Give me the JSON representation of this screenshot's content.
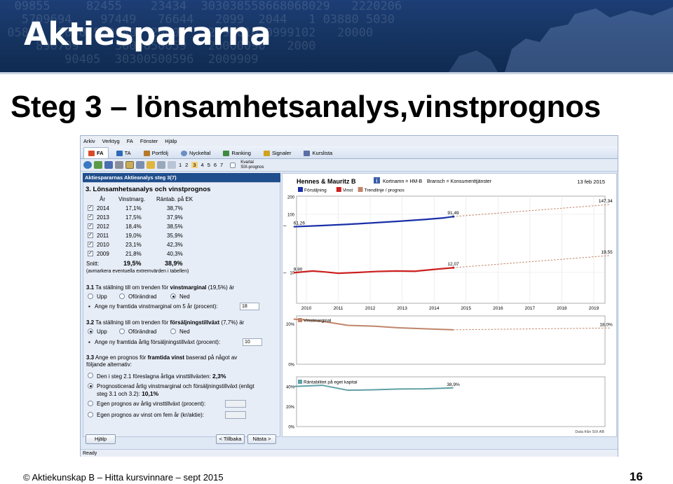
{
  "banner": {
    "logo": "Aktiespararna",
    "bg_numbers": "  09855     82455    23434  303038558668068029   2220206\n   5709694    97449   76644   2099  2044   1 03880 5030\n 05800  2000 500080  2000    299101010999102   20000\n     890709     3000050059   20000090   2000\n         90405  30300500596  2009909  "
  },
  "slide": {
    "title": "Steg 3 – lönsamhetsanalys,vinstprognos",
    "footer": "© Aktiekunskap B – Hitta kursvinnare – sept 2015",
    "page_number": "16"
  },
  "app": {
    "menu": [
      "Arkiv",
      "Verktyg",
      "FA",
      "Fönster",
      "Hjälp"
    ],
    "tabs": [
      {
        "label": "FA",
        "active": true,
        "color": "#d94a2a"
      },
      {
        "label": "TA",
        "active": false,
        "color": "#2e6bb8"
      },
      {
        "label": "Portfölj",
        "active": false,
        "color": "#b57a2a"
      },
      {
        "label": "Nyckeltal",
        "active": false,
        "color": "#6a8fc4"
      },
      {
        "label": "Ranking",
        "active": false,
        "color": "#3f8a3f"
      },
      {
        "label": "Signaler",
        "active": false,
        "color": "#d1a21c"
      },
      {
        "label": "Kurslista",
        "active": false,
        "color": "#5a6fa5"
      }
    ],
    "toolbar": {
      "steps": [
        "1",
        "2",
        "3",
        "4",
        "5",
        "6",
        "7"
      ],
      "kvartal": "Kvartal",
      "six": "SIX-prognos"
    },
    "panel_header": "Aktiespararnas Aktieanalys steg 3(7)",
    "section_title": "3. Lönsamhetsanalys och vinstprognos",
    "table": {
      "headers": [
        "År",
        "Vinstmarg.",
        "Räntab. på EK"
      ],
      "rows": [
        {
          "year": "2014",
          "margin": "17,1%",
          "roe": "38,7%",
          "checked": true
        },
        {
          "year": "2013",
          "margin": "17,5%",
          "roe": "37,9%",
          "checked": true
        },
        {
          "year": "2012",
          "margin": "18,4%",
          "roe": "38,5%",
          "checked": true
        },
        {
          "year": "2011",
          "margin": "19,0%",
          "roe": "35,9%",
          "checked": true
        },
        {
          "year": "2010",
          "margin": "23,1%",
          "roe": "42,3%",
          "checked": true
        },
        {
          "year": "2009",
          "margin": "21,8%",
          "roe": "40,3%",
          "checked": true
        }
      ],
      "avg_label": "Snitt:",
      "avg_margin": "19,5%",
      "avg_roe": "38,9%",
      "note": "(avmarkera eventuella extremvärden i tabellen)"
    },
    "q31": {
      "num": "3.1",
      "pre": "Ta ställning till om trenden för",
      "bold": "vinstmarginal",
      "post": "(19,5%) är",
      "opts": [
        "Upp",
        "Oförändrad",
        "Ned"
      ],
      "selected": 2,
      "input_label": "Ange ny framtida vinstmarginal om 5 år (procent):",
      "input_value": "18"
    },
    "q32": {
      "num": "3.2",
      "pre": "Ta ställning till om trenden för",
      "bold": "försäljningstillväxt",
      "post": "(7,7%) är",
      "opts": [
        "Upp",
        "Oförändrad",
        "Ned"
      ],
      "selected": 0,
      "input_label": "Ange ny framtida årlig försäljningstillväxt (procent):",
      "input_value": "10"
    },
    "q33": {
      "num": "3.3",
      "line1_pre": "Ange en prognos för",
      "line1_bold": "framtida vinst",
      "line1_post": "baserad på något av",
      "line2": "följande alternativ:",
      "opt1_pre": "Den i steg 2.1 föreslagna årliga vinsttillväxten:",
      "opt1_val": "2,3%",
      "opt2_l1": "Prognosticerad årlig vinstmarginal och försäljningstillväxt (enligt",
      "opt2_l2": "steg 3.1 och 3.2):",
      "opt2_val": "10,1%",
      "opt3": "Egen prognos av årlig vinsttillväxt (procent):",
      "opt4": "Egen prognos av vinst om fem år (kr/aktie):",
      "selected": 1
    },
    "buttons": {
      "help": "Hjälp",
      "back": "< Tillbaka",
      "next": "Nästa >"
    },
    "status": "Ready",
    "chart_header": {
      "company": "Hennes & Mauritz B",
      "short": "Kortnamn = HM-B",
      "sector": "Bransch = Konsumenttjänster",
      "date": "13 feb 2015",
      "source": "Data från SIX AB"
    }
  },
  "chart_data": [
    {
      "type": "line",
      "title": "",
      "x": [
        "2010",
        "2011",
        "2012",
        "2013",
        "2014",
        "2015",
        "2016",
        "2017",
        "2018",
        "2019"
      ],
      "yscale": "log",
      "ytick_labels": [
        "200",
        "100",
        "10"
      ],
      "legend": [
        "Försäljning",
        "Vinst",
        "Trendlinje / prognos"
      ],
      "legend_colors": [
        "#1a2fa8",
        "#cc2020",
        "#c0856a"
      ],
      "series": [
        {
          "name": "Försäljning",
          "color": "#1a2fa8",
          "x": [
            2009.6,
            2010.5,
            2011.3,
            2012.1,
            2012.9,
            2013.7,
            2014.3,
            2014.6
          ],
          "y": [
            61.26,
            64.2,
            67.3,
            71.4,
            76.1,
            81.5,
            86.8,
            91.49
          ]
        },
        {
          "name": "Vinst",
          "color": "#cc2020",
          "x": [
            2009.6,
            2010.2,
            2010.6,
            2011.0,
            2011.6,
            2012.2,
            2012.8,
            2013.4,
            2014.0,
            2014.6
          ],
          "y": [
            9.9,
            10.6,
            10.2,
            9.7,
            10.0,
            10.4,
            10.6,
            10.5,
            11.3,
            12.07
          ]
        },
        {
          "name": "Trendlinje / prognos",
          "color": "#c0856a",
          "x": [
            2014.6,
            2019.5
          ],
          "y": [
            91.49,
            147.34
          ]
        },
        {
          "name": "Trendlinje / prognos",
          "color": "#c0856a",
          "x": [
            2014.6,
            2019.5
          ],
          "y": [
            12.07,
            19.55
          ]
        }
      ],
      "labels": [
        {
          "text": "61,26",
          "x": 2009.6,
          "y": 61.26
        },
        {
          "text": "91,49",
          "x": 2014.6,
          "y": 91.49
        },
        {
          "text": "147,34",
          "x": 2019.5,
          "y": 147.34
        },
        {
          "text": "9,90",
          "x": 2009.6,
          "y": 9.9
        },
        {
          "text": "12,07",
          "x": 2014.6,
          "y": 12.07
        },
        {
          "text": "19,55",
          "x": 2019.5,
          "y": 19.55
        }
      ]
    },
    {
      "type": "line",
      "title": "",
      "series_label": "Vinstmarginal",
      "ytick_labels": [
        "20%",
        "0%"
      ],
      "ylim": [
        0,
        24
      ],
      "series": [
        {
          "name": "Vinstmarginal",
          "color": "#c0856a",
          "x": [
            2009.6,
            2010.5,
            2011.3,
            2012.1,
            2012.9,
            2013.7,
            2014.6
          ],
          "y": [
            22.4,
            21.3,
            19.3,
            18.9,
            18.1,
            17.6,
            17.1
          ]
        },
        {
          "name": "prognos",
          "color": "#c0856a",
          "x": [
            2014.6,
            2019.5
          ],
          "y": [
            17.1,
            18.0
          ]
        }
      ],
      "end_label": "18,0%"
    },
    {
      "type": "line",
      "title": "",
      "series_label": "Räntabilitet på eget kapital",
      "ytick_labels": [
        "40%",
        "20%",
        "0%"
      ],
      "ylim": [
        0,
        50
      ],
      "series": [
        {
          "name": "Räntabilitet på eget kapital",
          "color": "#5fa0a6",
          "x": [
            2009.6,
            2010.5,
            2011.3,
            2012.1,
            2012.9,
            2013.7,
            2014.6
          ],
          "y": [
            40.3,
            41.5,
            36.5,
            37.0,
            37.8,
            37.9,
            38.9
          ]
        }
      ],
      "end_label": "38,9%"
    }
  ]
}
